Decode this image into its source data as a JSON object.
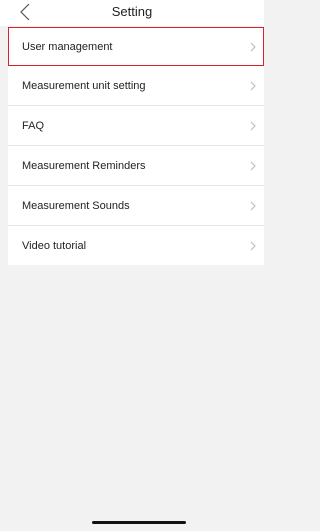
{
  "header": {
    "title": "Setting",
    "back_icon": "chevron-left-icon"
  },
  "menu": {
    "items": [
      {
        "label": "User management",
        "highlighted": true
      },
      {
        "label": "Measurement unit setting"
      },
      {
        "label": "FAQ"
      },
      {
        "label": "Measurement Reminders"
      },
      {
        "label": "Measurement Sounds"
      },
      {
        "label": "Video tutorial"
      }
    ],
    "chevron_icon": "chevron-right-icon",
    "highlight_color": "#d6222e"
  }
}
